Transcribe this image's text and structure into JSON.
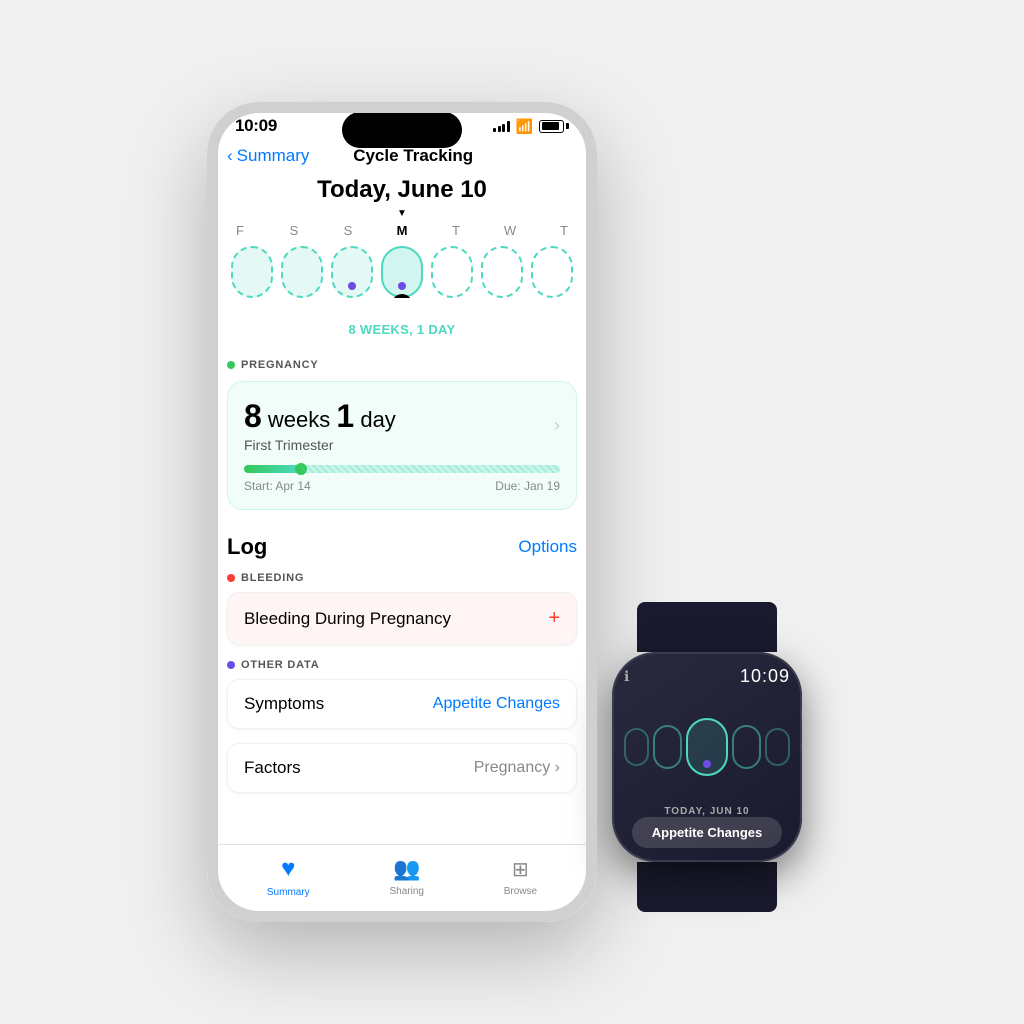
{
  "scene": {
    "background": "#f0f0f0"
  },
  "iphone": {
    "status_bar": {
      "time": "10:09",
      "signal": "●●●●",
      "wifi": "wifi",
      "battery": "battery"
    },
    "nav": {
      "back_label": "Summary",
      "title": "Cycle Tracking"
    },
    "calendar": {
      "date_title": "Today, June 10",
      "weeks_label": "8 WEEKS, 1 DAY",
      "weekdays": [
        "F",
        "S",
        "S",
        "M",
        "T",
        "W",
        "T"
      ],
      "active_day_index": 3,
      "active_day_letter": "M"
    },
    "pregnancy": {
      "section_label": "PREGNANCY",
      "weeks_num": "8",
      "weeks_label": "weeks",
      "days_num": "1",
      "days_label": "day",
      "trimester": "First Trimester",
      "start": "Start: Apr 14",
      "due": "Due: Jan 19",
      "progress_pct": 18
    },
    "log": {
      "title": "Log",
      "options": "Options",
      "bleeding_label": "BLEEDING",
      "bleeding_row": "Bleeding During Pregnancy",
      "other_data_label": "OTHER DATA",
      "symptoms_row": "Symptoms",
      "symptoms_value": "Appetite Changes",
      "factors_row": "Factors",
      "factors_value": "Pregnancy ›"
    },
    "tab_bar": {
      "tabs": [
        {
          "label": "Summary",
          "icon": "❤️",
          "active": true
        },
        {
          "label": "Sharing",
          "icon": "👥",
          "active": false
        },
        {
          "label": "Browse",
          "icon": "⊞",
          "active": false
        }
      ]
    }
  },
  "watch": {
    "time": "10:09",
    "date_label": "TODAY, JUN 10",
    "symptom": "Appetite Changes"
  }
}
